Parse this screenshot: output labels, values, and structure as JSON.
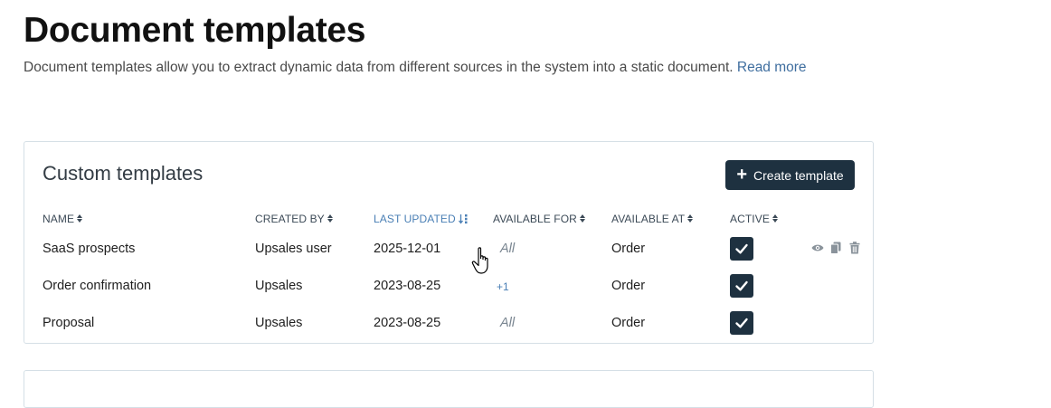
{
  "header": {
    "title": "Document templates",
    "description": "Document templates allow you to extract dynamic data from different sources in the system into a static document.",
    "read_more": "Read more"
  },
  "custom_templates": {
    "title": "Custom templates",
    "create_button": "Create template",
    "columns": {
      "name": "NAME",
      "created_by": "CREATED BY",
      "last_updated": "LAST UPDATED",
      "available_for": "AVAILABLE FOR",
      "available_at": "AVAILABLE AT",
      "active": "ACTIVE"
    },
    "rows": [
      {
        "name": "SaaS prospects",
        "created_by": "Upsales user",
        "last_updated": "2025-12-01",
        "available_for": "All",
        "available_at": "Order",
        "active": true
      },
      {
        "name": "Order confirmation",
        "created_by": "Upsales",
        "last_updated": "2023-08-25",
        "available_for": "+1",
        "available_at": "Order",
        "active": true
      },
      {
        "name": "Proposal",
        "created_by": "Upsales",
        "last_updated": "2023-08-25",
        "available_for": "All",
        "available_at": "Order",
        "active": true
      }
    ]
  },
  "colors": {
    "accent": "#1e3140",
    "link": "#3f6e9f",
    "sorted_header": "#4a7fb5"
  },
  "icons": [
    "plus-icon",
    "sort-icon",
    "sort-desc-icon",
    "checkmark-icon",
    "eye-icon",
    "copy-icon",
    "trash-icon",
    "hand-cursor-icon"
  ]
}
